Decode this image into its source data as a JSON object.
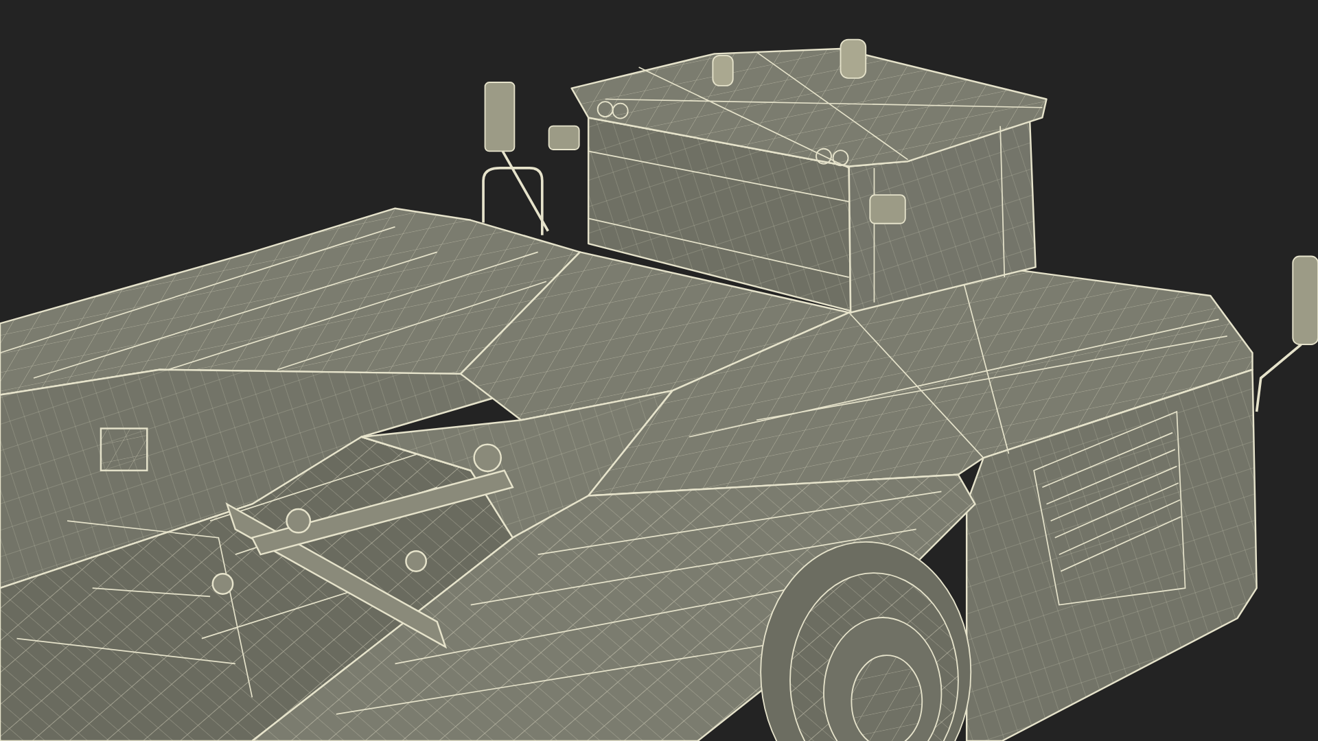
{
  "scene": {
    "kind": "wireframe-vehicle"
  }
}
